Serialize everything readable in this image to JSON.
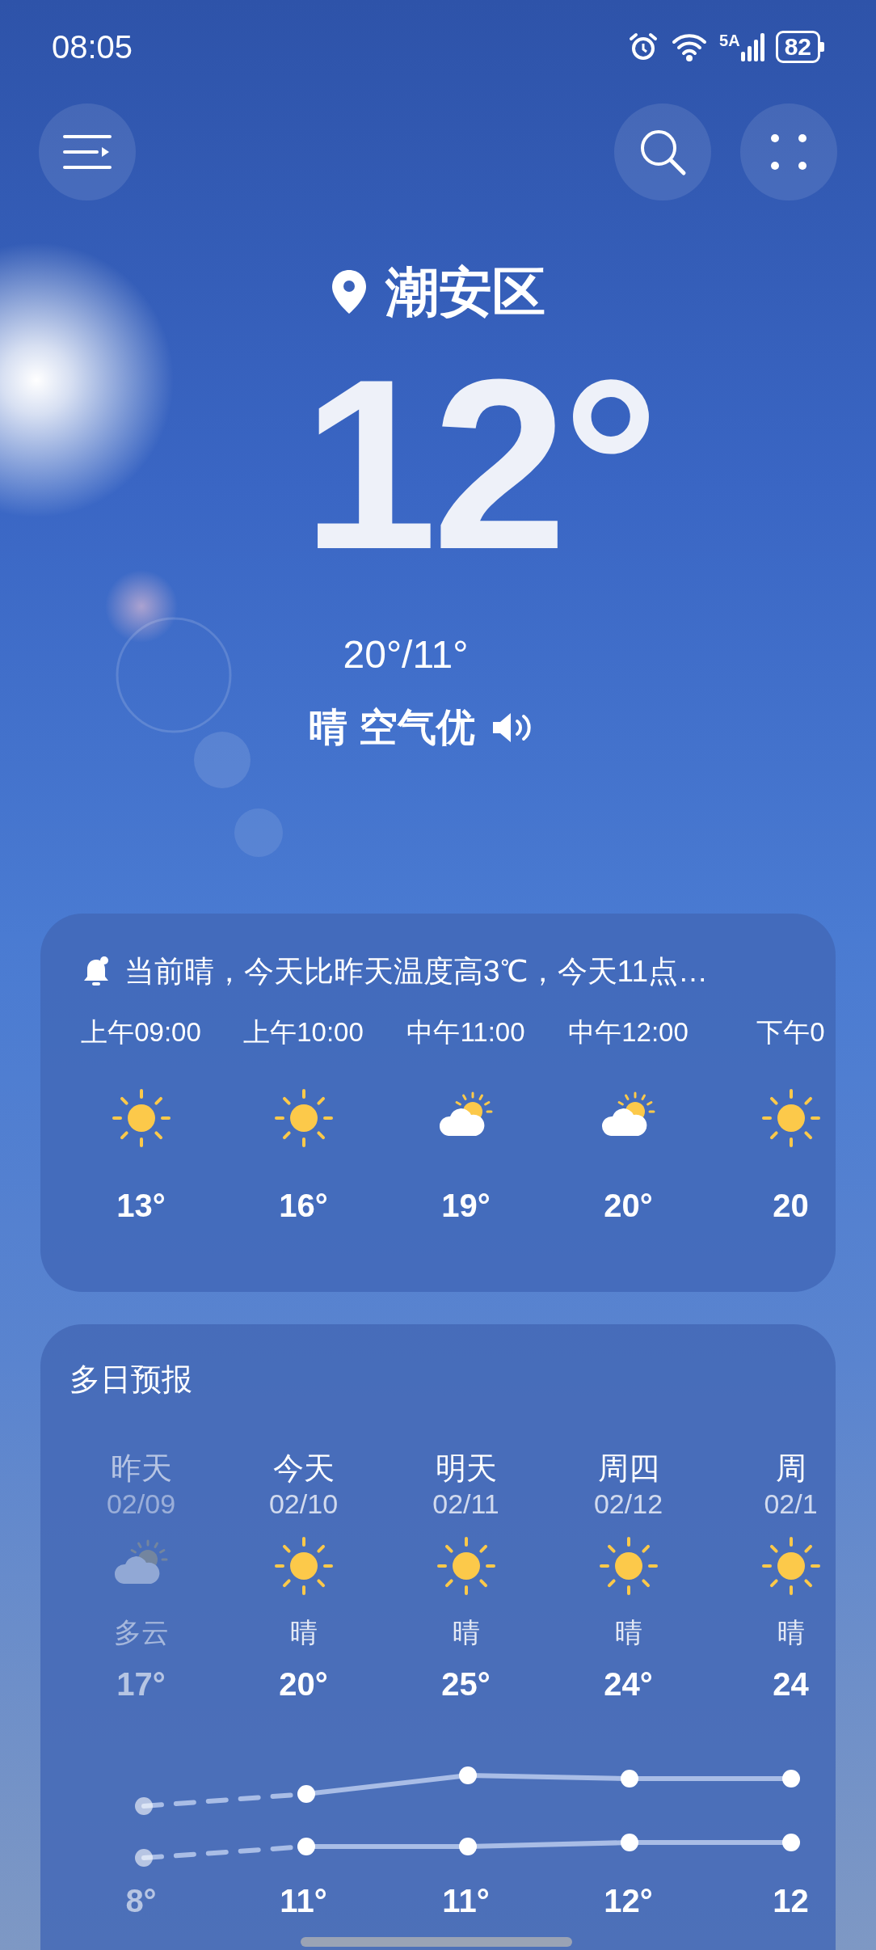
{
  "status_bar": {
    "time": "08:05",
    "network": "5A",
    "battery": "82"
  },
  "location": "潮安区",
  "current": {
    "temp": "12°",
    "range": "20°/11°",
    "summary": "晴 空气优"
  },
  "hourly": {
    "alert": "当前晴，今天比昨天温度高3℃，今天11点…",
    "hours": [
      {
        "time": "上午09:00",
        "kind": "sun",
        "temp": "13°"
      },
      {
        "time": "上午10:00",
        "kind": "sun",
        "temp": "16°"
      },
      {
        "time": "中午11:00",
        "kind": "partly_cloudy",
        "temp": "19°"
      },
      {
        "time": "中午12:00",
        "kind": "partly_cloudy",
        "temp": "20°"
      },
      {
        "time": "下午0",
        "kind": "sun",
        "temp": "20"
      }
    ]
  },
  "daily": {
    "title": "多日预报",
    "days": [
      {
        "day": "昨天",
        "date": "02/09",
        "kind": "partly_cloudy",
        "condition": "多云",
        "high": "17°",
        "low": "8°",
        "past": true
      },
      {
        "day": "今天",
        "date": "02/10",
        "kind": "sun",
        "condition": "晴",
        "high": "20°",
        "low": "11°",
        "past": false
      },
      {
        "day": "明天",
        "date": "02/11",
        "kind": "sun",
        "condition": "晴",
        "high": "25°",
        "low": "11°",
        "past": false
      },
      {
        "day": "周四",
        "date": "02/12",
        "kind": "sun",
        "condition": "晴",
        "high": "24°",
        "low": "12°",
        "past": false
      },
      {
        "day": "周",
        "date": "02/1",
        "kind": "sun",
        "condition": "晴",
        "high": "24",
        "low": "12",
        "past": false
      }
    ]
  }
}
